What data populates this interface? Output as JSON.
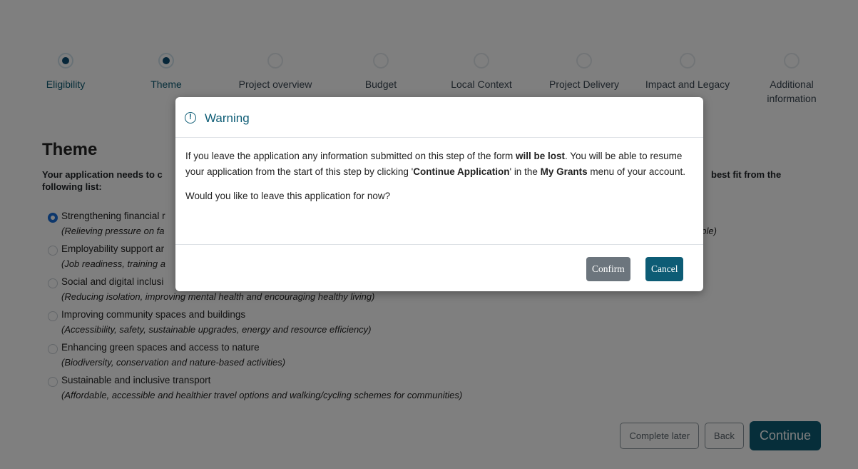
{
  "stepper": {
    "steps": [
      {
        "label": "Eligibility",
        "state": "done"
      },
      {
        "label": "Theme",
        "state": "current"
      },
      {
        "label": "Project overview",
        "state": "todo"
      },
      {
        "label": "Budget",
        "state": "todo"
      },
      {
        "label": "Local Context",
        "state": "todo"
      },
      {
        "label": "Project Delivery",
        "state": "todo"
      },
      {
        "label": "Impact and Legacy",
        "state": "todo"
      },
      {
        "label": "Additional information",
        "state": "todo"
      }
    ]
  },
  "theme": {
    "heading": "Theme",
    "intro_left": "Your application needs to c",
    "intro_left2": "following list:",
    "intro_right": "best fit from the",
    "options": [
      {
        "title": "Strengthening financial r",
        "desc": "(Relieving pressure on fa",
        "extra": "ople)",
        "checked": true
      },
      {
        "title": "Employability support ar",
        "desc": "(Job readiness, training a",
        "extra": "",
        "checked": false
      },
      {
        "title": "Social and digital inclusi",
        "desc": "(Reducing isolation, improving mental health and encouraging healthy living)",
        "extra": "",
        "checked": false
      },
      {
        "title": "Improving community spaces and buildings",
        "desc": "(Accessibility, safety, sustainable upgrades, energy and resource efficiency)",
        "extra": "",
        "checked": false
      },
      {
        "title": "Enhancing green spaces and access to nature",
        "desc": "(Biodiversity, conservation and nature-based activities)",
        "extra": "",
        "checked": false
      },
      {
        "title": "Sustainable and inclusive transport",
        "desc": "(Affordable, accessible and healthier travel options and walking/cycling schemes for communities)",
        "extra": "",
        "checked": false
      }
    ]
  },
  "actions": {
    "complete_later": "Complete later",
    "back": "Back",
    "continue": "Continue"
  },
  "modal": {
    "icon": "exclamation-circle-icon",
    "title": "Warning",
    "p1_a": "If you leave the application any information submitted on this step of the form ",
    "p1_b": "will be lost",
    "p1_c": ". You will be able to resume your application from the start of this step by clicking '",
    "p1_d": "Continue Application",
    "p1_e": "' in the ",
    "p1_f": "My Grants",
    "p1_g": " menu of your account.",
    "p2": "Would you like to leave this application for now?",
    "confirm": "Confirm",
    "cancel": "Cancel"
  },
  "colors": {
    "primary": "#0d5c75",
    "radio_checked": "#1a6fd8",
    "confirm_bg": "#6c757d"
  }
}
